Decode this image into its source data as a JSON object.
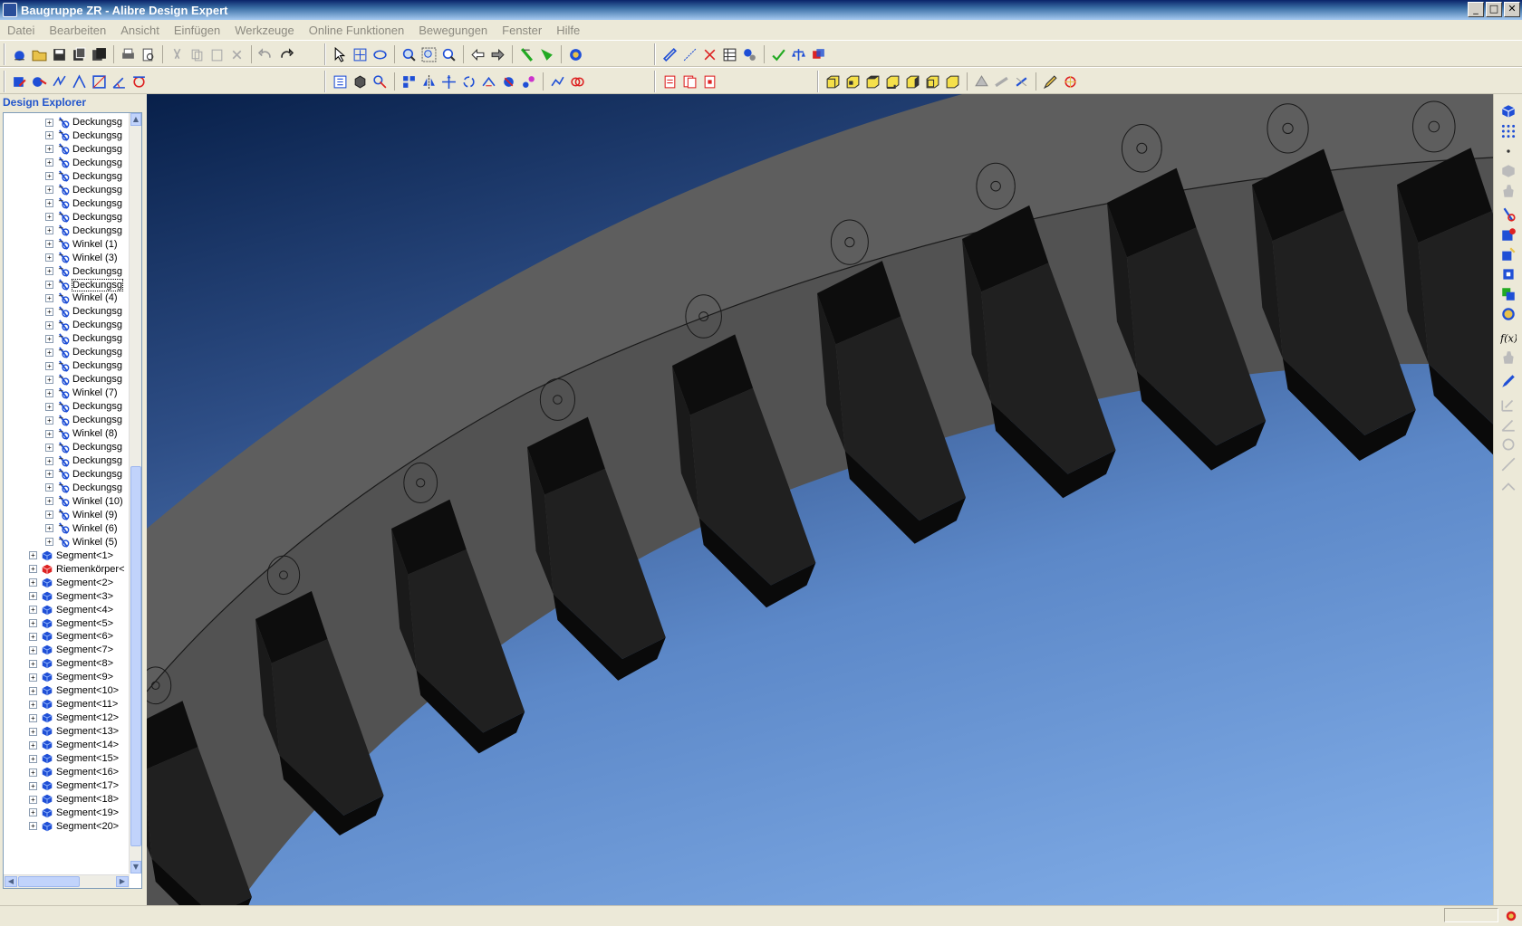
{
  "window": {
    "title": "Baugruppe ZR - Alibre Design Expert",
    "buttons": [
      "minimize-button",
      "maximize-button",
      "close-button"
    ]
  },
  "menu": [
    "Datei",
    "Bearbeiten",
    "Ansicht",
    "Einfügen",
    "Werkzeuge",
    "Online Funktionen",
    "Bewegungen",
    "Fenster",
    "Hilfe"
  ],
  "explorer": {
    "title": "Design Explorer",
    "constraints": [
      "Deckungsg",
      "Deckungsg",
      "Deckungsg",
      "Deckungsg",
      "Deckungsg",
      "Deckungsg",
      "Deckungsg",
      "Deckungsg",
      "Deckungsg",
      "Winkel (1)",
      "Winkel (3)",
      "Deckungsg",
      "Deckungsg",
      "Winkel (4)",
      "Deckungsg",
      "Deckungsg",
      "Deckungsg",
      "Deckungsg",
      "Deckungsg",
      "Deckungsg",
      "Winkel (7)",
      "Deckungsg",
      "Deckungsg",
      "Winkel (8)",
      "Deckungsg",
      "Deckungsg",
      "Deckungsg",
      "Deckungsg",
      "Winkel (10)",
      "Winkel (9)",
      "Winkel (6)",
      "Winkel (5)"
    ],
    "parts": [
      "Segment<1>",
      "Riemenkörper<",
      "Segment<2>",
      "Segment<3>",
      "Segment<4>",
      "Segment<5>",
      "Segment<6>",
      "Segment<7>",
      "Segment<8>",
      "Segment<9>",
      "Segment<10>",
      "Segment<11>",
      "Segment<12>",
      "Segment<13>",
      "Segment<14>",
      "Segment<15>",
      "Segment<16>",
      "Segment<17>",
      "Segment<18>",
      "Segment<19>",
      "Segment<20>"
    ]
  },
  "colors": {
    "viewport_bg_top": "#08204a",
    "viewport_bg_bottom": "#84b0ea",
    "ring_face": "#5a5a5a",
    "tooth_dark": "#1c1c1c",
    "part_icon": "#1f4fd6",
    "explorer_title": "#2255cc"
  }
}
